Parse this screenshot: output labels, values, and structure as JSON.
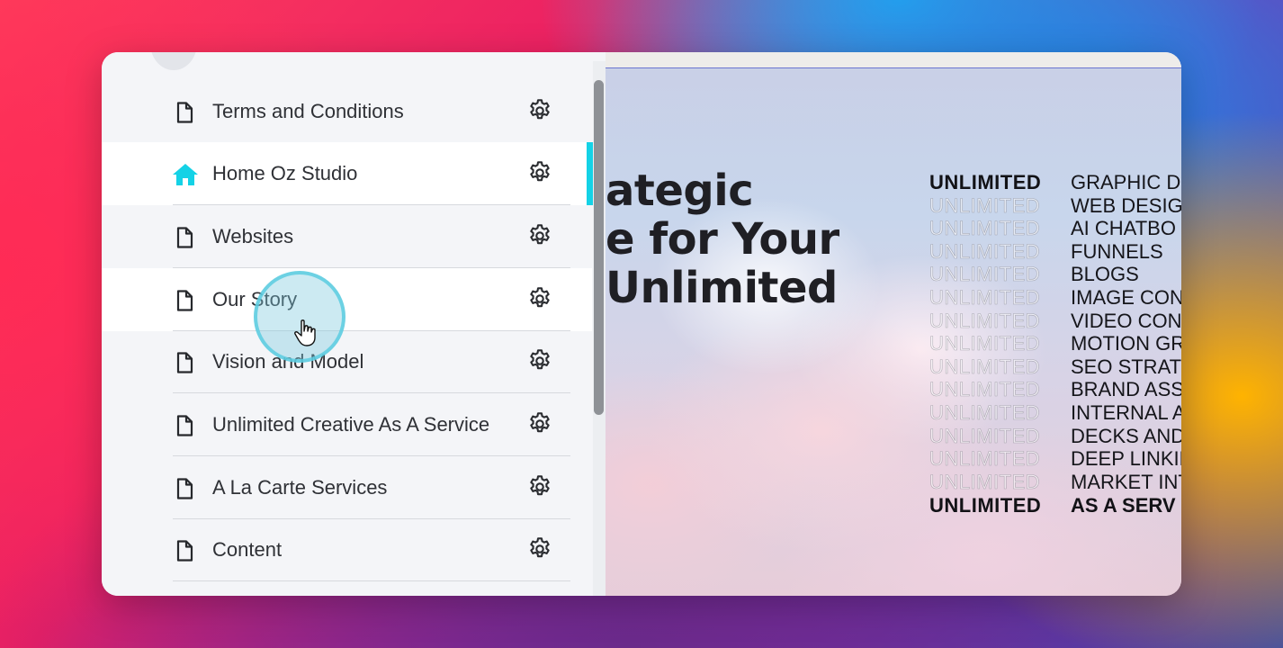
{
  "sidebar": {
    "pages": [
      {
        "label": "Terms and Conditions",
        "icon": "page-icon",
        "highlight": false
      },
      {
        "label": "Home Oz Studio",
        "icon": "home-icon",
        "highlight": true,
        "active": true
      },
      {
        "label": "Websites",
        "icon": "page-icon",
        "highlight": false
      },
      {
        "label": "Our Story",
        "icon": "page-icon",
        "highlight": true
      },
      {
        "label": "Vision and Model",
        "icon": "page-icon",
        "highlight": false
      },
      {
        "label": "Unlimited Creative As A Service",
        "icon": "page-icon",
        "highlight": false
      },
      {
        "label": "A La Carte Services",
        "icon": "page-icon",
        "highlight": false
      },
      {
        "label": "Content",
        "icon": "page-icon",
        "highlight": false
      }
    ],
    "accent_color": "#14d2e6"
  },
  "preview": {
    "headline": [
      "ategic",
      "e for Your",
      "Unlimited"
    ],
    "unlimited_word": "UNLIMITED",
    "services": [
      "GRAPHIC D",
      "WEB DESIG",
      "AI CHATBO",
      "FUNNELS",
      "BLOGS",
      "IMAGE CON",
      "VIDEO CON",
      "MOTION GR",
      "SEO STRATI",
      "BRAND ASS",
      "INTERNAL A",
      "DECKS AND",
      "DEEP LINKIN",
      "MARKET INT"
    ],
    "final_line": "AS A SERV"
  }
}
